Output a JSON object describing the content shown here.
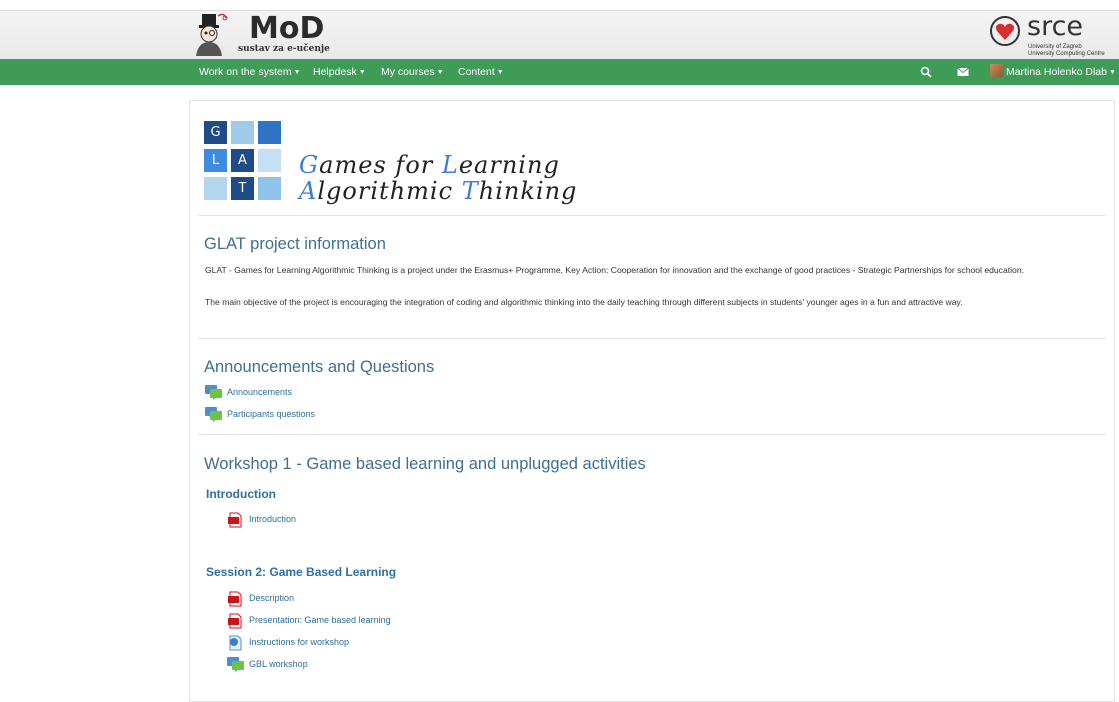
{
  "header": {
    "logo_title": "MoD",
    "logo_subtitle": "sustav za e-učenje",
    "partner_word": "srce",
    "partner_line1": "University of Zagreb",
    "partner_line2": "University Computing Centre"
  },
  "nav": {
    "items": [
      {
        "label": "Work on the system"
      },
      {
        "label": "Helpdesk"
      },
      {
        "label": "My courses"
      },
      {
        "label": "Content"
      }
    ],
    "user_name": "Martina Holenko Dlab",
    "icons": [
      "search-icon",
      "envelope-icon"
    ],
    "accent_color": "#3f9c56"
  },
  "banner": {
    "letters": [
      "G",
      "L",
      "A",
      "T"
    ],
    "line1": "Games for Learning",
    "line2": "Algorithmic Thinking"
  },
  "info": {
    "title": "GLAT project information",
    "para1": "GLAT - Games for Learning Algorithmic Thinking is a project under the Erasmus+ Programme, Key Action: Cooperation for innovation and the exchange of good practices - Strategic Partnerships for school education.",
    "para2": "The main objective of the project is encouraging the integration of coding and algorithmic thinking into the daily teaching through different subjects in students' younger ages in a fun and attractive way."
  },
  "announcements": {
    "title": "Announcements and Questions",
    "items": [
      {
        "label": "Announcements",
        "icon": "forum-icon"
      },
      {
        "label": "Participants questions",
        "icon": "forum-icon"
      }
    ]
  },
  "workshop": {
    "title": "Workshop 1 - Game based learning and unplugged activities",
    "sections": [
      {
        "title": "Introduction",
        "items": [
          {
            "label": "Introduction",
            "icon": "pdf-icon"
          }
        ]
      },
      {
        "title": "Session 2: Game Based Learning",
        "items": [
          {
            "label": "Description",
            "icon": "pdf-icon"
          },
          {
            "label": "Presentation: Game based learning",
            "icon": "pdf-icon"
          },
          {
            "label": "Instructions for workshop",
            "icon": "page-icon"
          },
          {
            "label": "GBL workshop",
            "icon": "forum-icon"
          }
        ]
      }
    ]
  }
}
